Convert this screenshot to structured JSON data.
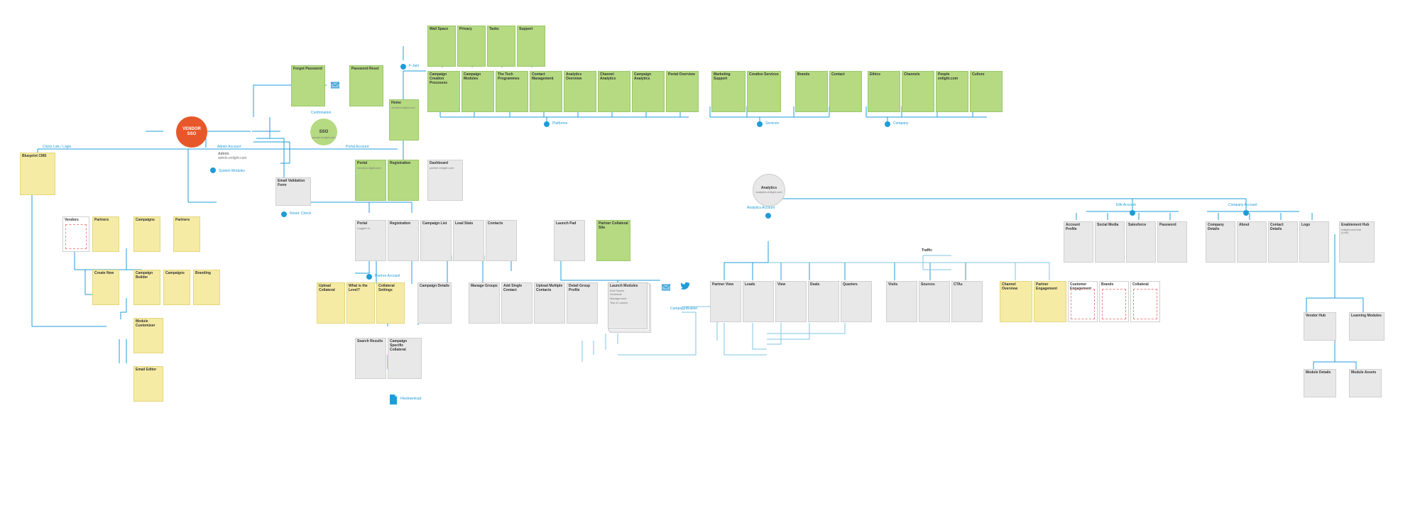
{
  "top_tabs": [
    "Wall Space",
    "Privacy",
    "Tasks",
    "Support"
  ],
  "vendor_sso": "VENDOR\nSSO",
  "sso": {
    "title": "SSO",
    "sub": "vendor.enlight.com"
  },
  "forgot_password": "Forgot Password",
  "password_reset": "Password Reset",
  "confirmation": "Confirmation",
  "home": {
    "title": "Home",
    "sub": "vendor.enlight.com"
  },
  "f_jam": "F-Jam",
  "platforms": "Platforms",
  "services": "Services",
  "company": "Company",
  "platform_row": [
    "Campaign\nCreation Processes",
    "Campaign\nModules",
    "The Tech\nProgrammes",
    "Contact\nManagement",
    "Analytics Overview",
    "Channel Analytics",
    "Campaign\nAnalytics",
    "Portal Overview"
  ],
  "services_row": [
    "Marketing Support",
    "Creative Services",
    "Brands",
    "Contact"
  ],
  "company_row": [
    "Ethics",
    "Channels",
    "People\nenlight.com",
    "Culture"
  ],
  "clicks_link": "Clicks Link / Login",
  "blueprint": "Blueprint CMS",
  "admin_label": "Admin Account",
  "admin_sub": "admin.enlight.com",
  "admin": {
    "title": "Admin",
    "sub": "admin.enlight.com"
  },
  "sys_mod": "System Modules",
  "email_validation": "Email Validation\nForm",
  "reset_check": "Reset: Check",
  "portal_label": "Portal Account",
  "portal1": {
    "title": "Portal",
    "sub": "vendor.enlight.com"
  },
  "registration1": "Registration",
  "dashboard": {
    "title": "Dashboard",
    "sub": "partner.enlight.com"
  },
  "portal_row4_first": {
    "title": "Portal",
    "sub": "Logged In"
  },
  "portal_row4": [
    "Registration",
    "Campaign List",
    "Lead Stats",
    "Contacts"
  ],
  "launch_pad": "Launch Pad",
  "partner_collateral": "Partner Collateral\nSite",
  "partner_account": "Partner Account",
  "yellow_row5": [
    "Upload\nCollateral",
    "What is the\nLevel?",
    "Collateral\nSettings"
  ],
  "campaign_details": "Campaign Details",
  "grey_row5": [
    "Manage Groups",
    "Add Single Contact",
    "Upload Multiple\nContacts",
    "Detail Group\nProfile"
  ],
  "launch_modules": {
    "title": "Launch Modules",
    "items": [
      "Edit Panels",
      "Schedule",
      "Management",
      "Test & Launch"
    ]
  },
  "search_results": "Search Results",
  "campaign_specific": "Campaign Specific\nCollateral",
  "file_download": "Filedownload",
  "campaign_builder": "CampaignBuilder",
  "vendors": "Vendors",
  "partners": "Partners",
  "campaigns": "Campaigns",
  "partners2": "Partners",
  "create_new": "Create New",
  "campaign_builder_y": "Campaign\nBuilder",
  "campaigns2": "Campaigns",
  "branding": "Branding",
  "module_customiser": "Module\nCustomiser",
  "email_editor": "Email Editor",
  "analytics": {
    "title": "Analytics",
    "sub": "analytics.enlight.com"
  },
  "analytics_account": "Analytics Account",
  "partner_row": [
    "Partner View",
    "Leads",
    "View",
    "Deals",
    "Quarters"
  ],
  "traffic": "Traffic",
  "traffic_row": [
    "Visits",
    "Sources",
    "CTAs"
  ],
  "yellow_rowR": [
    "Channel Overview",
    "Partner Engagement"
  ],
  "white_rowR": [
    "Customer\nEngagement",
    "Brands",
    "Collateral"
  ],
  "edit_account": "Edit Account",
  "company_account": "Company Account",
  "edit_row": [
    "Account Profile",
    "Social Media",
    "Salesforce",
    "Password"
  ],
  "company_row2": [
    "Company Details",
    "About",
    "Contact Details",
    "Logo"
  ],
  "enablement": {
    "title": "Enablement Hub",
    "sub": "enlight.com/hub\n(Link)"
  },
  "vendor_hub": "Vendor Hub",
  "learning_mod": "Learning Modules",
  "module_detail": "Module Details",
  "module_assets": "Module Assets"
}
